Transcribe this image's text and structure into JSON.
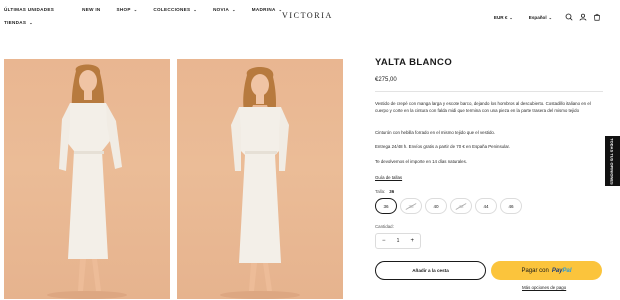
{
  "header": {
    "nav": [
      {
        "label": "ÚLTIMAS UNIDADES",
        "dropdown": false
      },
      {
        "label": "NEW IN",
        "dropdown": false
      },
      {
        "label": "SHOP",
        "dropdown": true
      },
      {
        "label": "COLECCIONES",
        "dropdown": true
      },
      {
        "label": "NOVIA",
        "dropdown": true
      },
      {
        "label": "MADRINA",
        "dropdown": true
      }
    ],
    "nav_row2": {
      "label": "TIENDAS",
      "dropdown": true
    },
    "logo": "VICTORIA",
    "currency": "EUR €",
    "language": "Español",
    "icons": [
      "search-icon",
      "account-icon",
      "cart-icon"
    ]
  },
  "product": {
    "title": "YALTA BLANCO",
    "price": "€275,00",
    "description": "Vestido de crepé con manga larga y escote barco, dejando los hombros al descubierto. Costadillo italiano en el cuerpo y corte en la cintura con falda midi que termina con una pieza en la parte trasera del mismo tejido",
    "belt": "Cinturón con hebilla forrado en el mismo tejido que el vestido.",
    "shipping": "Entrega 24/48 h. Envíos gratis a partir de 70 € en España Peninsular.",
    "returns": "Te devolvemos el importe en 14 días naturales.",
    "size_guide": "Guía de tallas",
    "size_label": "Talla:",
    "selected_size": "36",
    "sizes": [
      {
        "label": "36",
        "state": "selected"
      },
      {
        "label": "38",
        "state": "soldout"
      },
      {
        "label": "40",
        "state": "available"
      },
      {
        "label": "42",
        "state": "soldout"
      },
      {
        "label": "44",
        "state": "available"
      },
      {
        "label": "46",
        "state": "available"
      }
    ],
    "quantity_label": "Cantidad:",
    "quantity": "1",
    "add_to_cart": "Añadir a la cesta",
    "paypal_prefix": "Pagar con",
    "paypal_brand_1": "Pay",
    "paypal_brand_2": "Pal",
    "more_payment": "Más opciones de pago"
  },
  "reviews_tab": "TODAS TUS OPINIONES",
  "colors": {
    "photo_background": "#e9b691",
    "paypal_yellow": "#fbc43c",
    "text": "#1a1a1a"
  }
}
